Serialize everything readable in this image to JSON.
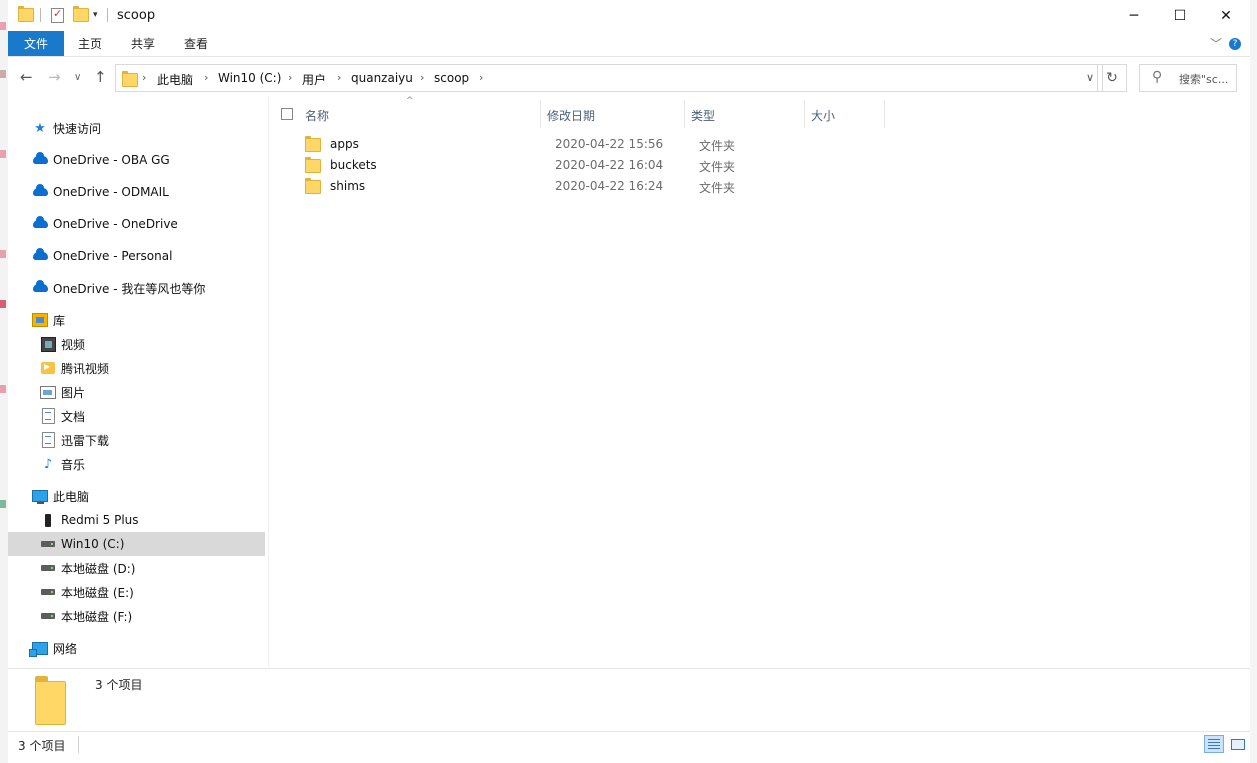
{
  "window": {
    "title": "scoop",
    "controls": {
      "minimize": "─",
      "maximize": "☐",
      "close": "✕"
    }
  },
  "ribbon": {
    "tabs": [
      "文件",
      "主页",
      "共享",
      "查看"
    ],
    "collapse_icon": "﹀",
    "help_icon": "?"
  },
  "address": {
    "crumbs": [
      "此电脑",
      "Win10 (C:)",
      "用户",
      "quanzaiyu",
      "scoop"
    ],
    "refresh_icon": "↻"
  },
  "search": {
    "placeholder": "搜索\"sc..."
  },
  "nav_pane": {
    "quick_access": "快速访问",
    "onedrive": [
      "OneDrive - OBA GG",
      "OneDrive - ODMAIL",
      "OneDrive - OneDrive",
      "OneDrive - Personal",
      "OneDrive - 我在等风也等你"
    ],
    "library": {
      "label": "库",
      "items": [
        "视频",
        "腾讯视频",
        "图片",
        "文档",
        "迅雷下载",
        "音乐"
      ]
    },
    "this_pc": {
      "label": "此电脑",
      "items": [
        "Redmi 5 Plus",
        "Win10 (C:)",
        "本地磁盘 (D:)",
        "本地磁盘 (E:)",
        "本地磁盘 (F:)"
      ],
      "selected": "Win10 (C:)"
    },
    "network": "网络"
  },
  "columns": [
    "名称",
    "修改日期",
    "类型",
    "大小"
  ],
  "files": [
    {
      "name": "apps",
      "date": "2020-04-22 15:56",
      "type": "文件夹"
    },
    {
      "name": "buckets",
      "date": "2020-04-22 16:04",
      "type": "文件夹"
    },
    {
      "name": "shims",
      "date": "2020-04-22 16:24",
      "type": "文件夹"
    }
  ],
  "details": {
    "count": "3 个项目"
  },
  "status": {
    "count": "3 个项目"
  },
  "colors": {
    "accent": "#1979ca",
    "selection": "#d9d9d9",
    "folder": "#ffd767",
    "onedrive": "#0a6fd0"
  }
}
